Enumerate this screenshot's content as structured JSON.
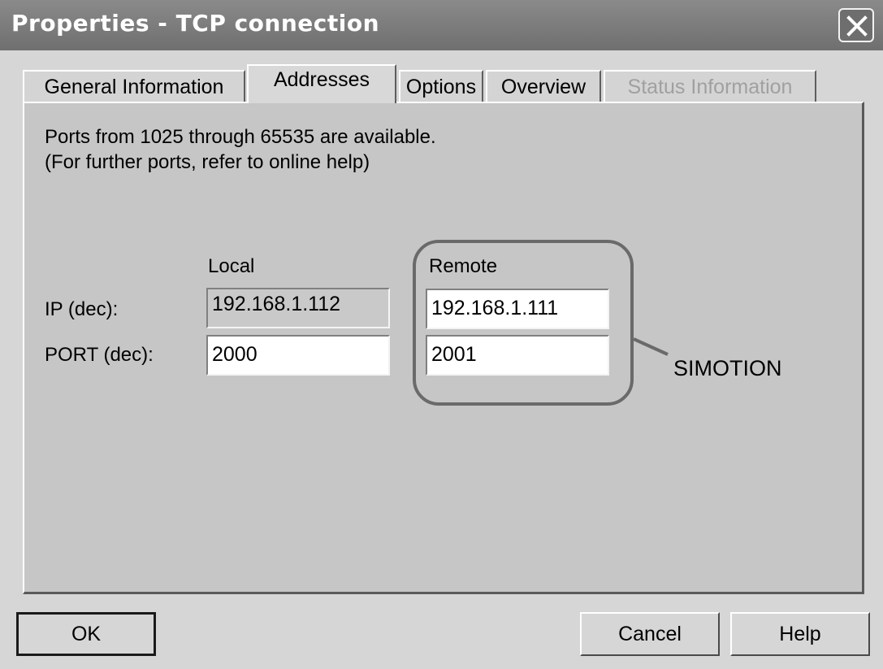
{
  "window": {
    "title": "Properties - TCP connection",
    "close_icon": "close-icon"
  },
  "tabs": [
    {
      "label": "General Information",
      "state": "normal"
    },
    {
      "label": "Addresses",
      "state": "active"
    },
    {
      "label": "Options",
      "state": "normal"
    },
    {
      "label": "Overview",
      "state": "normal"
    },
    {
      "label": "Status Information",
      "state": "disabled"
    }
  ],
  "panel": {
    "info_line1": "Ports from 1025 through 65535 are available.",
    "info_line2": "(For further ports, refer to online help)",
    "local_header": "Local",
    "remote_header": "Remote",
    "ip_label": "IP (dec):",
    "port_label": "PORT (dec):",
    "local_ip": "192.168.1.112",
    "local_port": "2000",
    "remote_ip": "192.168.1.111",
    "remote_port": "2001",
    "annotation": "SIMOTION"
  },
  "buttons": {
    "ok": "OK",
    "cancel": "Cancel",
    "help": "Help"
  },
  "colors": {
    "titlebar": "#7d7d7d",
    "panel": "#c6c6c6",
    "window": "#d6d6d6"
  }
}
